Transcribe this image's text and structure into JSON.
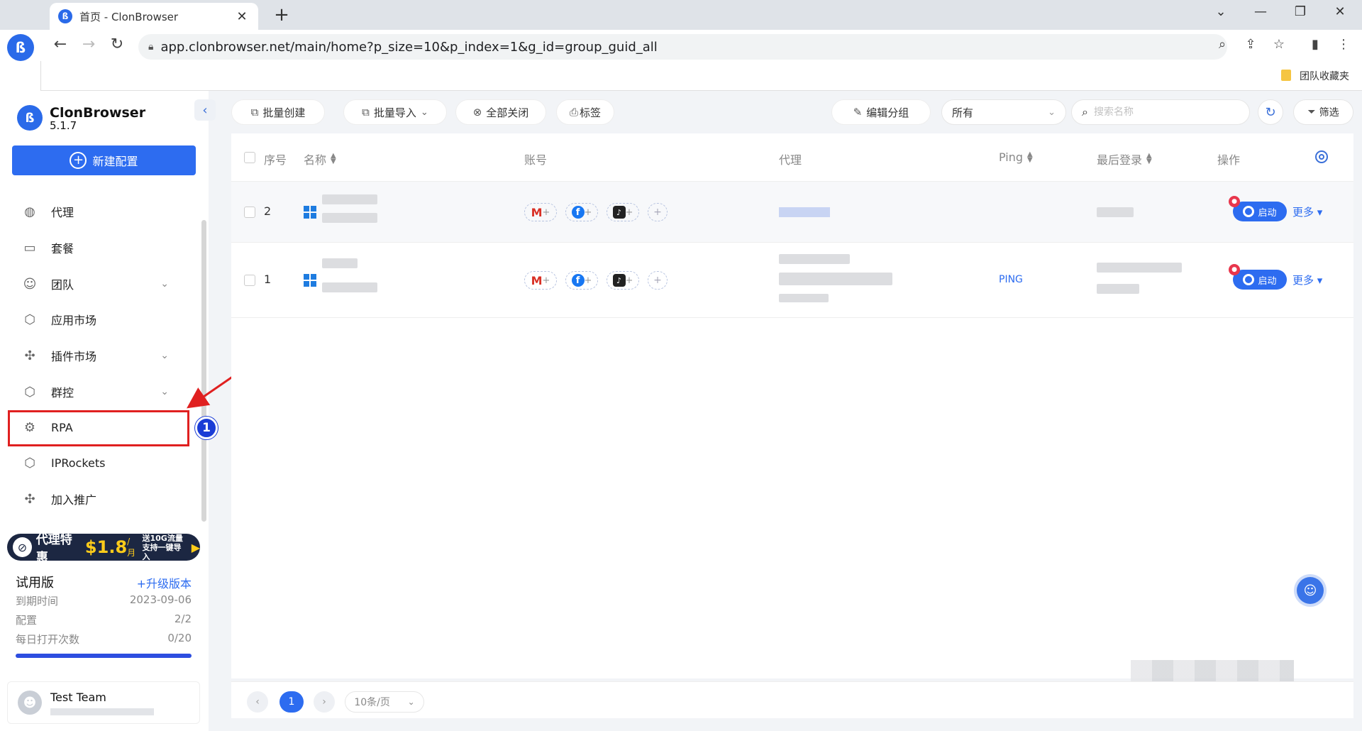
{
  "browser": {
    "tab_title": "首页 - ClonBrowser",
    "url": "app.clonbrowser.net/main/home?p_size=10&p_index=1&g_id=group_guid_all",
    "bookmark_folder": "团队收藏夹"
  },
  "app": {
    "name": "ClonBrowser",
    "version": "5.1.7",
    "new_config_label": "新建配置"
  },
  "sidebar": {
    "items": [
      {
        "label": "代理",
        "icon": "globe-icon"
      },
      {
        "label": "套餐",
        "icon": "wallet-icon"
      },
      {
        "label": "团队",
        "icon": "team-icon",
        "expandable": true
      },
      {
        "label": "应用市场",
        "icon": "cube-icon"
      },
      {
        "label": "插件市场",
        "icon": "puzzle-icon",
        "expandable": true
      },
      {
        "label": "群控",
        "icon": "cube-icon",
        "expandable": true
      },
      {
        "label": "RPA",
        "icon": "robot-icon"
      },
      {
        "label": "IPRockets",
        "icon": "cube-icon"
      },
      {
        "label": "加入推广",
        "icon": "puzzle-icon"
      }
    ],
    "step_badge": "1"
  },
  "promo": {
    "text": "代理特惠",
    "price": "$1.8",
    "unit": "/月",
    "sub_line1": "送10G流量",
    "sub_line2": "支持一键导入"
  },
  "plan": {
    "title": "试用版",
    "upgrade": "+升级版本",
    "rows": [
      {
        "label": "到期时间",
        "value": "2023-09-06"
      },
      {
        "label": "配置",
        "value": "2/2"
      },
      {
        "label": "每日打开次数",
        "value": "0/20"
      }
    ],
    "progress": 1.0
  },
  "team": {
    "name": "Test Team"
  },
  "toolbar": {
    "batch_create": "批量创建",
    "batch_import": "批量导入",
    "close_all": "全部关闭",
    "tags": "标签",
    "edit_group": "编辑分组",
    "group_select": "所有",
    "search_placeholder": "搜索名称",
    "filter": "筛选"
  },
  "table": {
    "headers": {
      "index": "序号",
      "name": "名称",
      "account": "账号",
      "proxy": "代理",
      "ping": "Ping",
      "last_login": "最后登录",
      "actions": "操作"
    },
    "rows": [
      {
        "index": "2",
        "ping": "",
        "start": "启动",
        "more": "更多"
      },
      {
        "index": "1",
        "ping": "PING",
        "start": "启动",
        "more": "更多"
      }
    ]
  },
  "pagination": {
    "current": "1",
    "page_size": "10条/页"
  },
  "colors": {
    "primary": "#2d6cf0",
    "highlight_box": "#e02020",
    "badge": "#1a3cd6"
  }
}
